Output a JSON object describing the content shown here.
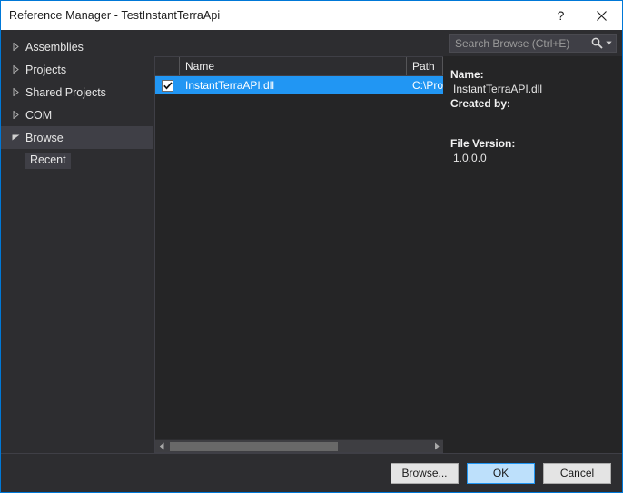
{
  "window": {
    "title": "Reference Manager - TestInstantTerraApi",
    "help_label": "?",
    "close_label": "close-icon",
    "accent_color": "#0078d7"
  },
  "sidebar": {
    "items": [
      {
        "label": "Assemblies",
        "expanded": false,
        "selected": false
      },
      {
        "label": "Projects",
        "expanded": false,
        "selected": false
      },
      {
        "label": "Shared Projects",
        "expanded": false,
        "selected": false
      },
      {
        "label": "COM",
        "expanded": false,
        "selected": false
      },
      {
        "label": "Browse",
        "expanded": true,
        "selected": true
      }
    ],
    "child": {
      "label": "Recent",
      "selected": true
    }
  },
  "list": {
    "columns": [
      {
        "key": "check",
        "label": ""
      },
      {
        "key": "name",
        "label": "Name"
      },
      {
        "key": "path",
        "label": "Path"
      }
    ],
    "rows": [
      {
        "checked": true,
        "name": "InstantTerraAPI.dll",
        "path": "C:\\Pro",
        "selected": true
      }
    ],
    "scrollbar": {
      "left_arrow": "chevron-left-icon",
      "right_arrow": "chevron-right-icon",
      "thumb_percent": 64
    }
  },
  "search": {
    "placeholder": "Search Browse (Ctrl+E)",
    "value": "",
    "icon": "search-icon",
    "caret": "chevron-down-icon"
  },
  "details": {
    "name_label": "Name:",
    "name_value": "InstantTerraAPI.dll",
    "created_by_label": "Created by:",
    "created_by_value": "",
    "file_version_label": "File Version:",
    "file_version_value": "1.0.0.0"
  },
  "footer": {
    "browse_label": "Browse...",
    "ok_label": "OK",
    "cancel_label": "Cancel"
  },
  "colors": {
    "selection_blue": "#2196f3",
    "panel_dark": "#252526",
    "chrome_dark": "#2d2d30",
    "hover_gray": "#3f3f46"
  }
}
